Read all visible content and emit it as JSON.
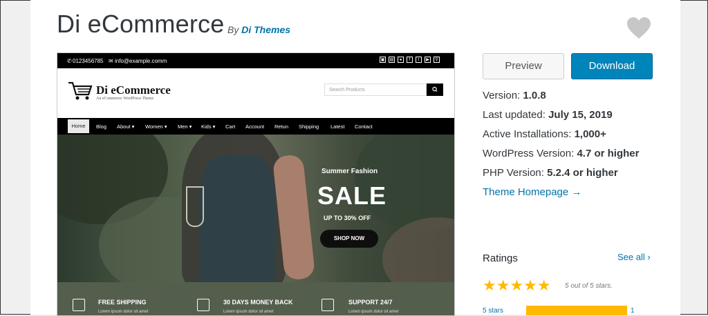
{
  "theme": {
    "title": "Di eCommerce",
    "by_prefix": "By",
    "author": "Di Themes",
    "favorite_icon": "heart-icon"
  },
  "screenshot": {
    "topbar": {
      "phone": "0123456785",
      "email": "info@example.comm",
      "social_icons": [
        "cart-icon",
        "bag-icon",
        "user-icon",
        "facebook-icon",
        "twitter-icon",
        "youtube-icon",
        "search-icon"
      ]
    },
    "logo": {
      "title": "Di eCommerce",
      "subtitle": "An eCommerce WordPress Theme"
    },
    "search": {
      "placeholder": "Search Products"
    },
    "nav": [
      {
        "label": "Home"
      },
      {
        "label": "Blog"
      },
      {
        "label": "About ▾"
      },
      {
        "label": "Women ▾"
      },
      {
        "label": "Men ▾"
      },
      {
        "label": "Kids ▾"
      },
      {
        "label": "Cart"
      },
      {
        "label": "Account"
      },
      {
        "label": "Retun"
      },
      {
        "label": "Shipping"
      },
      {
        "label": "Latest"
      },
      {
        "label": "Contact"
      }
    ],
    "hero": {
      "tagline": "Summer Fashion",
      "headline": "SALE",
      "offer": "UP TO 30% OFF",
      "button": "SHOP NOW"
    },
    "features": [
      {
        "title": "FREE SHIPPING",
        "desc": "Lorem ipsum dolor sit amet",
        "icon": "truck-icon"
      },
      {
        "title": "30 DAYS MONEY BACK",
        "desc": "Lorem ipsum dolor sit amet",
        "icon": "calendar-icon"
      },
      {
        "title": "SUPPORT 24/7",
        "desc": "Lorem ipsum dolor sit amet",
        "icon": "phone-icon"
      }
    ]
  },
  "actions": {
    "preview": "Preview",
    "download": "Download"
  },
  "meta": {
    "version_label": "Version:",
    "version": "1.0.8",
    "updated_label": "Last updated:",
    "updated": "July 15, 2019",
    "installs_label": "Active Installations:",
    "installs": "1,000+",
    "wp_label": "WordPress Version:",
    "wp": "4.7 or higher",
    "php_label": "PHP Version:",
    "php": "5.2.4 or higher",
    "homepage": "Theme Homepage →"
  },
  "ratings": {
    "heading": "Ratings",
    "see_all": "See all ›",
    "stars": "★★★★★",
    "summary": "5 out of 5 stars.",
    "rows": [
      {
        "label": "5 stars",
        "count": "1",
        "fraction": 1.0
      }
    ]
  }
}
